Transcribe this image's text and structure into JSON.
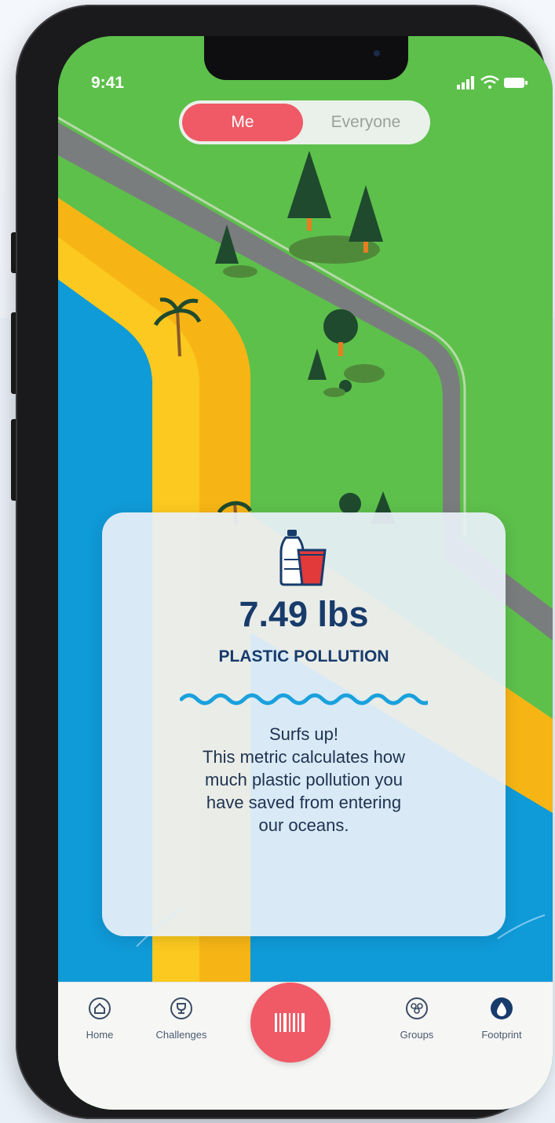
{
  "status_bar": {
    "time": "9:41"
  },
  "toggle": {
    "me_label": "Me",
    "everyone_label": "Everyone",
    "selected": "Me"
  },
  "metric_card": {
    "icon": "plastic-bottle-cup-icon",
    "value": "7.49 lbs",
    "label": "PLASTIC POLLUTION",
    "description_lines": [
      "Surfs up!",
      "This metric calculates how",
      "much plastic pollution you",
      "have saved from entering",
      "our oceans."
    ]
  },
  "tab_bar": {
    "items": [
      {
        "label": "Home",
        "icon": "home-icon"
      },
      {
        "label": "Challenges",
        "icon": "trophy-icon"
      },
      {
        "label": "Groups",
        "icon": "groups-icon"
      },
      {
        "label": "Footprint",
        "icon": "footprint-drop-icon",
        "active": true
      }
    ],
    "scan_icon": "barcode-icon"
  },
  "colors": {
    "accent": "#ef5a66",
    "navy": "#173b6b",
    "grass": "#5dc04b",
    "ocean": "#0f9ad8",
    "sand": "#f6b515"
  }
}
